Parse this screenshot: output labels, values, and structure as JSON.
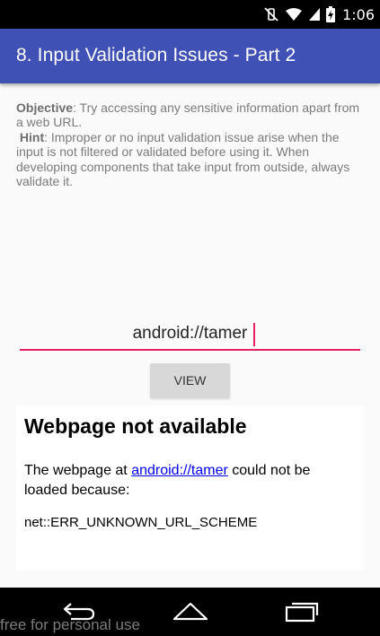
{
  "status_bar": {
    "time": "1:06",
    "icons": [
      "vibrate-off-icon",
      "wifi-icon",
      "signal-icon",
      "battery-charging-icon"
    ]
  },
  "app_bar": {
    "title": "8. Input Validation Issues - Part 2"
  },
  "description": {
    "objective_label": "Objective",
    "objective_text": ": Try accessing any sensitive information apart from a web URL.",
    "hint_label": "Hint",
    "hint_text": ": Improper or no input validation issue arise when the input is not filtered or validated before using it. When developing components that take input from outside, always validate it."
  },
  "url_input": {
    "value": "android://tamer"
  },
  "view_button": {
    "label": "VIEW"
  },
  "webview": {
    "heading": "Webpage not available",
    "body_prefix": "The webpage at ",
    "body_link": "android://tamer",
    "body_suffix": " could not be loaded because:",
    "error": "net::ERR_UNKNOWN_URL_SCHEME"
  },
  "nav_bar": {
    "icons": [
      "back-icon",
      "home-icon",
      "recents-icon"
    ]
  },
  "watermark": {
    "text": "free for personal use"
  },
  "colors": {
    "app_bar": "#3f51b5",
    "accent": "#e91e63",
    "link": "#0000ee"
  }
}
